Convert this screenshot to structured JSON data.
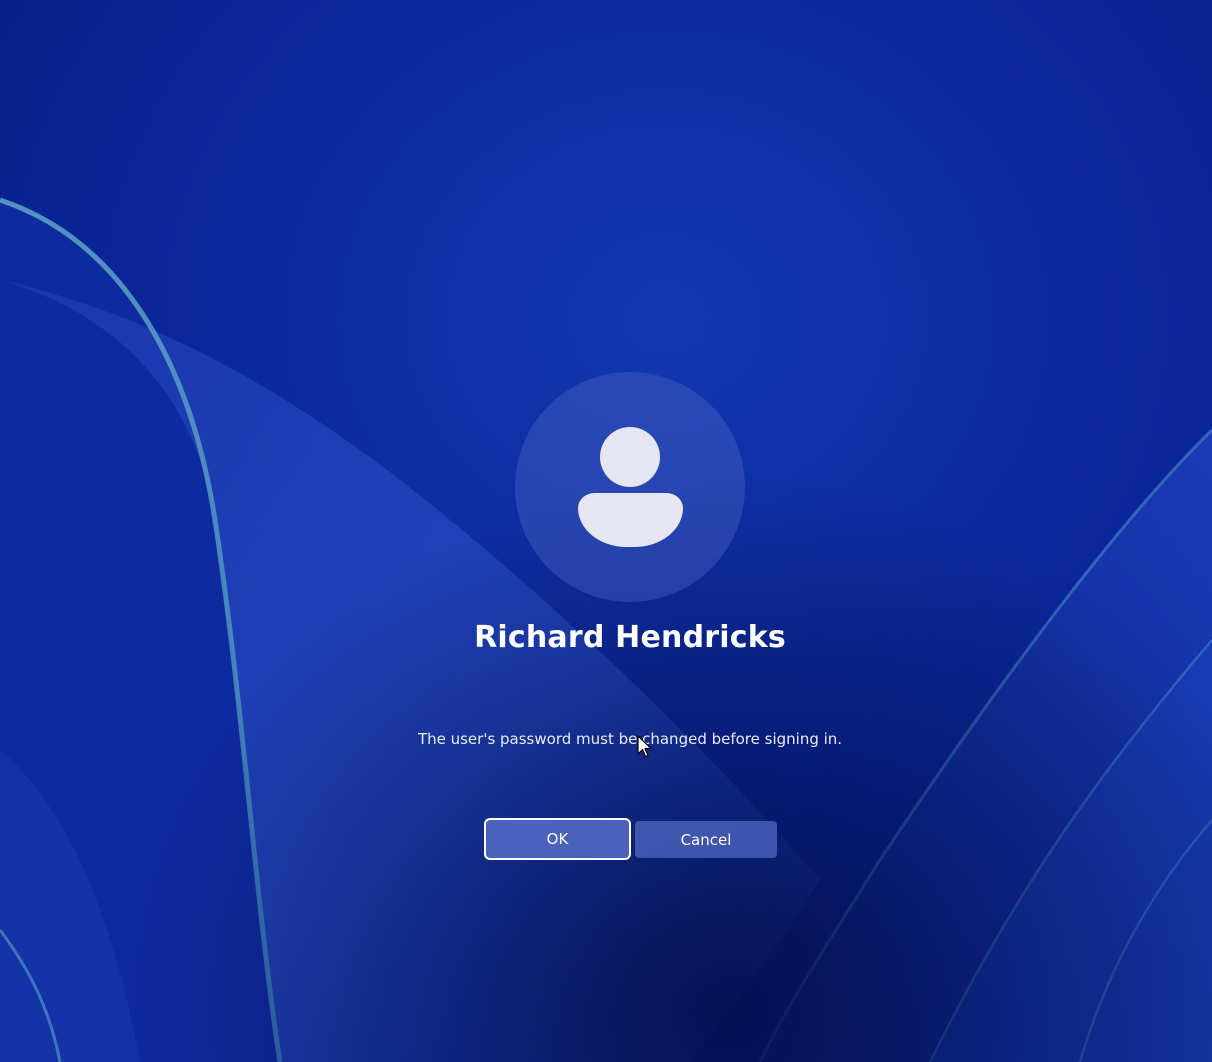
{
  "user": {
    "name": "Richard Hendricks",
    "avatar_icon": "user-avatar-icon"
  },
  "dialog": {
    "message": "The user's password must be changed before signing in.",
    "ok_label": "OK",
    "cancel_label": "Cancel"
  },
  "colors": {
    "background": "#0a2090",
    "accent": "#6076d2",
    "text": "#ffffff"
  }
}
